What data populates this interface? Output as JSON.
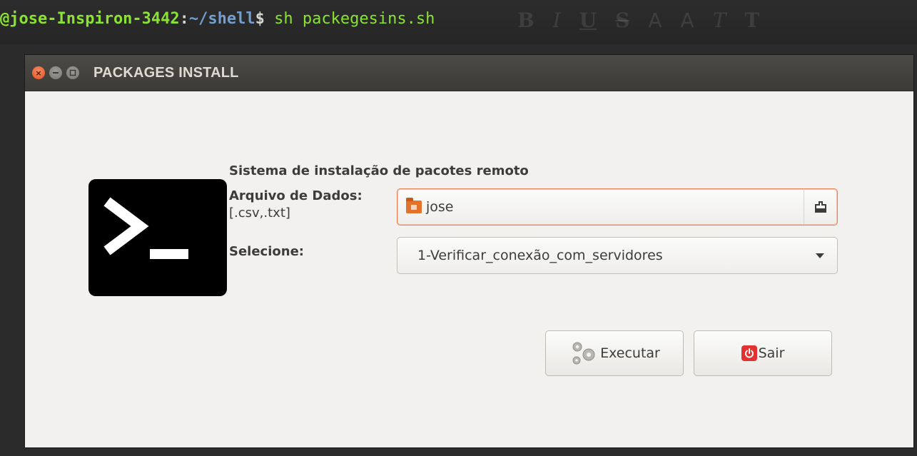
{
  "terminal": {
    "user": "@jose-Inspiron-3442",
    "colon": ":",
    "path": "~/shell",
    "dollar": "$",
    "command": "sh packegesins.sh"
  },
  "window": {
    "title": "PACKAGES INSTALL"
  },
  "form": {
    "heading": "Sistema de instalação de pacotes remoto",
    "data_file_label": "Arquivo de Dados:",
    "data_file_ext": "[.csv,.txt]",
    "data_file_value": "jose",
    "select_label": "Selecione:",
    "select_value": "1-Verificar_conexão_com_servidores"
  },
  "buttons": {
    "execute": "Executar",
    "exit": "Sair"
  },
  "icons": {
    "close": "close-icon",
    "minimize": "minimize-icon",
    "maximize": "maximize-icon",
    "terminal": "terminal-icon",
    "folder": "home-folder-icon",
    "open": "open-file-icon",
    "dropdown": "chevron-down-icon",
    "gears": "gears-icon",
    "power": "power-icon"
  },
  "colors": {
    "focus_border": "#e0865a",
    "title_bar": "#3c3b37",
    "window_bg": "#f2f1f0",
    "close_button": "#e2531c",
    "prompt_green": "#8ae234",
    "prompt_blue": "#729fcf",
    "power_red": "#e33030"
  }
}
